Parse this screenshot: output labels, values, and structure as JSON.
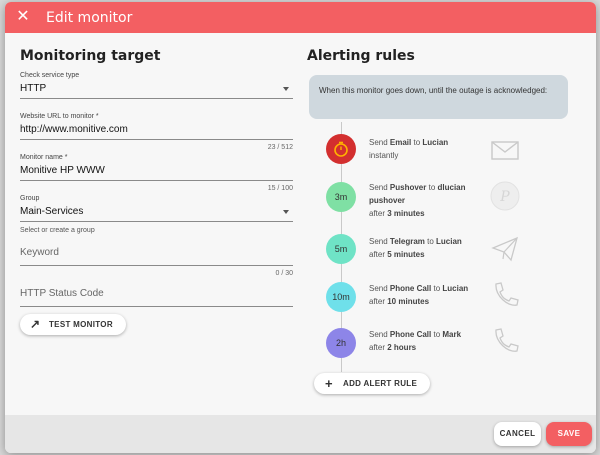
{
  "dialog": {
    "title": "Edit monitor",
    "close_icon": "close-icon"
  },
  "left": {
    "section_title": "Monitoring target",
    "service_type": {
      "label": "Check service type",
      "value": "HTTP"
    },
    "url": {
      "label": "Website URL to monitor *",
      "value": "http://www.monitive.com",
      "counter": "23 / 512"
    },
    "name": {
      "label": "Monitor name *",
      "value": "Monitive HP WWW",
      "counter": "15 / 100"
    },
    "group": {
      "label": "Group",
      "value": "Main-Services",
      "hint": "Select or create a group"
    },
    "keyword": {
      "placeholder": "Keyword",
      "counter": "0 / 30"
    },
    "status_code": {
      "placeholder": "HTTP Status Code"
    },
    "test_button": {
      "label": "TEST MONITOR",
      "icon": "arrow-up-right-icon"
    }
  },
  "right": {
    "section_title": "Alerting rules",
    "callout": "When this monitor goes down, until the outage is acknowledged:",
    "rules": [
      {
        "badge": "",
        "badge_icon": "stopwatch-icon",
        "color": "#d32f2f",
        "pre": "Send ",
        "channel": "Email",
        "mid": " to ",
        "person": "Lucian",
        "when_pre": "",
        "when": "instantly",
        "icon": "email-icon"
      },
      {
        "badge": "3m",
        "color": "#7fe0a4",
        "pre": "Send ",
        "channel": "Pushover",
        "mid": " to ",
        "person": "dlucian pushover",
        "when_pre": "after ",
        "when": "3 minutes",
        "icon": "pushover-icon"
      },
      {
        "badge": "5m",
        "color": "#6fe3c6",
        "pre": "Send ",
        "channel": "Telegram",
        "mid": " to ",
        "person": "Lucian",
        "when_pre": "after ",
        "when": "5 minutes",
        "icon": "telegram-icon"
      },
      {
        "badge": "10m",
        "color": "#6fe0ea",
        "pre": "Send ",
        "channel": "Phone Call",
        "mid": " to ",
        "person": "Lucian",
        "when_pre": "after ",
        "when": "10 minutes",
        "icon": "phone-icon"
      },
      {
        "badge": "2h",
        "color": "#8d85e8",
        "pre": "Send ",
        "channel": "Phone Call",
        "mid": " to ",
        "person": "Mark",
        "when_pre": "after ",
        "when": "2 hours",
        "icon": "phone-icon"
      }
    ],
    "add_rule": {
      "label": "ADD ALERT RULE",
      "icon": "plus-icon"
    }
  },
  "footer": {
    "cancel": "CANCEL",
    "save": "SAVE"
  },
  "colors": {
    "accent": "#f35f62",
    "callout_bg": "#cfd8de"
  }
}
